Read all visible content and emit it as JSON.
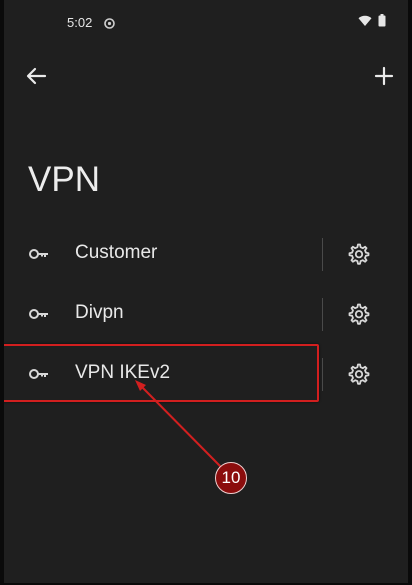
{
  "status_bar": {
    "time": "5:02"
  },
  "header": {
    "back_icon": "arrow-left-icon",
    "add_icon": "plus-icon"
  },
  "page": {
    "title": "VPN"
  },
  "vpn_list": [
    {
      "name": "Customer",
      "icon": "key-icon",
      "settings_icon": "gear-icon"
    },
    {
      "name": "Divpn",
      "icon": "key-icon",
      "settings_icon": "gear-icon"
    },
    {
      "name": "VPN IKEv2",
      "icon": "key-icon",
      "settings_icon": "gear-icon"
    }
  ],
  "annotation": {
    "step": "10",
    "color": "#d21f1f",
    "badge_color": "#8b0d0d"
  }
}
